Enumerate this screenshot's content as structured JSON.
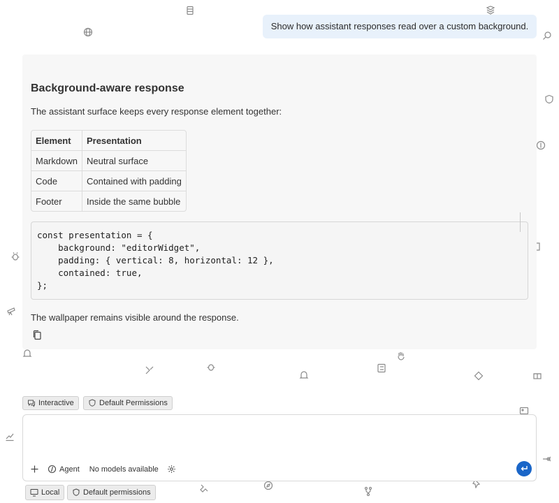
{
  "user_message": "Show how assistant responses read over a custom background.",
  "response": {
    "title": "Background-aware response",
    "intro": "The assistant surface keeps every response element together:",
    "table": {
      "headers": [
        "Element",
        "Presentation"
      ],
      "rows": [
        [
          "Markdown",
          "Neutral surface"
        ],
        [
          "Code",
          "Contained with padding"
        ],
        [
          "Footer",
          "Inside the same bubble"
        ]
      ]
    },
    "code": "const presentation = {\n    background: \"editorWidget\",\n    padding: { vertical: 8, horizontal: 12 },\n    contained: true,\n};",
    "outro": "The wallpaper remains visible around the response.",
    "copy_icon": "copy-icon"
  },
  "chips": {
    "interactive": "Interactive",
    "default_permissions": "Default Permissions"
  },
  "input": {
    "placeholder": "",
    "add_icon": "plus-icon",
    "mode_label": "Agent",
    "model_label": "No models available",
    "settings_icon": "gear-icon",
    "send_icon": "enter-icon"
  },
  "status_bar": {
    "local_label": "Local",
    "permissions_label": "Default permissions"
  },
  "colors": {
    "accent": "#1a66c8",
    "user_bubble": "#e8f1fb",
    "response_surface": "#f7f7f7"
  }
}
